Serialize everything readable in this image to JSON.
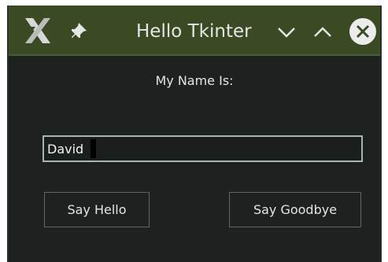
{
  "window": {
    "title": "Hello Tkinter",
    "icons": {
      "app": "x-logo-icon",
      "pin": "pin-icon",
      "minimize": "chevron-down-icon",
      "maximize": "chevron-up-icon",
      "close": "close-circle-icon"
    }
  },
  "form": {
    "label": "My Name Is:",
    "name_value": "David",
    "hello_button": "Say Hello",
    "goodbye_button": "Say Goodbye"
  },
  "colors": {
    "titlebar": "#3a4a22",
    "background": "#1d2221",
    "text": "#e4e4e4",
    "entry_border": "#a8b4b2"
  }
}
